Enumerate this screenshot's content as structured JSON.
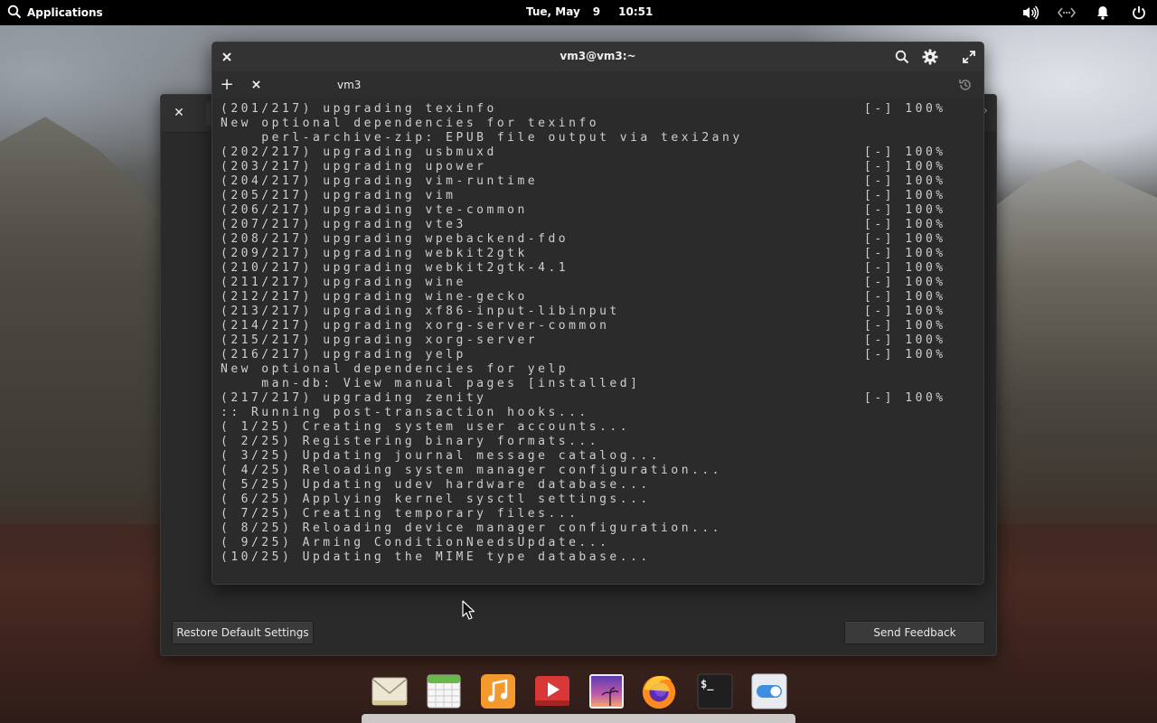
{
  "top_panel": {
    "applications_label": "Applications",
    "date_day": "Tue, May",
    "date_num": "9",
    "time": "10:51",
    "tray_icons": [
      "speaker-icon",
      "network-icon",
      "bell-icon",
      "power-icon"
    ]
  },
  "settings_window": {
    "restore_label": "Restore Default Settings",
    "feedback_label": "Send Feedback"
  },
  "terminal": {
    "title": "vm3@vm3:~",
    "tab_label": "vm3",
    "lines": [
      {
        "text": "(201/217) upgrading texinfo",
        "status": "[-] 100%"
      },
      {
        "text": "New optional dependencies for texinfo",
        "status": ""
      },
      {
        "text": "    perl-archive-zip: EPUB file output via texi2any",
        "status": ""
      },
      {
        "text": "(202/217) upgrading usbmuxd",
        "status": "[-] 100%"
      },
      {
        "text": "(203/217) upgrading upower",
        "status": "[-] 100%"
      },
      {
        "text": "(204/217) upgrading vim-runtime",
        "status": "[-] 100%"
      },
      {
        "text": "(205/217) upgrading vim",
        "status": "[-] 100%"
      },
      {
        "text": "(206/217) upgrading vte-common",
        "status": "[-] 100%"
      },
      {
        "text": "(207/217) upgrading vte3",
        "status": "[-] 100%"
      },
      {
        "text": "(208/217) upgrading wpebackend-fdo",
        "status": "[-] 100%"
      },
      {
        "text": "(209/217) upgrading webkit2gtk",
        "status": "[-] 100%"
      },
      {
        "text": "(210/217) upgrading webkit2gtk-4.1",
        "status": "[-] 100%"
      },
      {
        "text": "(211/217) upgrading wine",
        "status": "[-] 100%"
      },
      {
        "text": "(212/217) upgrading wine-gecko",
        "status": "[-] 100%"
      },
      {
        "text": "(213/217) upgrading xf86-input-libinput",
        "status": "[-] 100%"
      },
      {
        "text": "(214/217) upgrading xorg-server-common",
        "status": "[-] 100%"
      },
      {
        "text": "(215/217) upgrading xorg-server",
        "status": "[-] 100%"
      },
      {
        "text": "(216/217) upgrading yelp",
        "status": "[-] 100%"
      },
      {
        "text": "New optional dependencies for yelp",
        "status": ""
      },
      {
        "text": "    man-db: View manual pages [installed]",
        "status": ""
      },
      {
        "text": "(217/217) upgrading zenity",
        "status": "[-] 100%"
      },
      {
        "text": ":: Running post-transaction hooks...",
        "status": ""
      },
      {
        "text": "( 1/25) Creating system user accounts...",
        "status": ""
      },
      {
        "text": "( 2/25) Registering binary formats...",
        "status": ""
      },
      {
        "text": "( 3/25) Updating journal message catalog...",
        "status": ""
      },
      {
        "text": "( 4/25) Reloading system manager configuration...",
        "status": ""
      },
      {
        "text": "( 5/25) Updating udev hardware database...",
        "status": ""
      },
      {
        "text": "( 6/25) Applying kernel sysctl settings...",
        "status": ""
      },
      {
        "text": "( 7/25) Creating temporary files...",
        "status": ""
      },
      {
        "text": "( 8/25) Reloading device manager configuration...",
        "status": ""
      },
      {
        "text": "( 9/25) Arming ConditionNeedsUpdate...",
        "status": ""
      },
      {
        "text": "(10/25) Updating the MIME type database...",
        "status": ""
      }
    ]
  },
  "dock": {
    "items": [
      {
        "name": "mail-icon",
        "color": "#e9e2cf"
      },
      {
        "name": "calendar-icon",
        "color": "#f4f4f4"
      },
      {
        "name": "music-icon",
        "color": "#f08a24"
      },
      {
        "name": "videos-icon",
        "color": "#d83a3a"
      },
      {
        "name": "photos-icon",
        "color": "#7a4ec2"
      },
      {
        "name": "firefox-icon",
        "color": "#ff7a18"
      },
      {
        "name": "terminal-icon",
        "color": "#1e1e1e"
      },
      {
        "name": "system-settings-icon",
        "color": "#e6e9ee"
      }
    ],
    "terminal_glyph": "$_"
  }
}
